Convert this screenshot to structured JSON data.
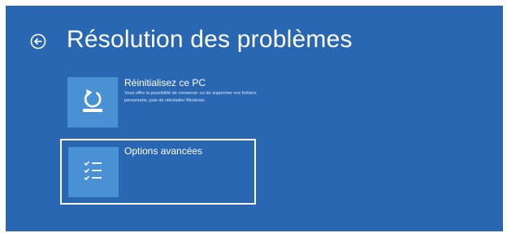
{
  "header": {
    "title": "Résolution des problèmes",
    "back_icon": "back-arrow-circle-icon"
  },
  "tiles": [
    {
      "title": "Réinitialisez ce PC",
      "description": "Vous offre la possibilité de conserver ou de supprimer vos fichiers personnels, puis de réinstaller Windows",
      "icon": "reset-pc-icon"
    },
    {
      "title": "Options avancées",
      "description": "",
      "icon": "checklist-icon",
      "selected": true
    }
  ],
  "colors": {
    "background": "#2a67b3",
    "tile_icon_background": "#4a90d4",
    "text": "#ffffff"
  }
}
